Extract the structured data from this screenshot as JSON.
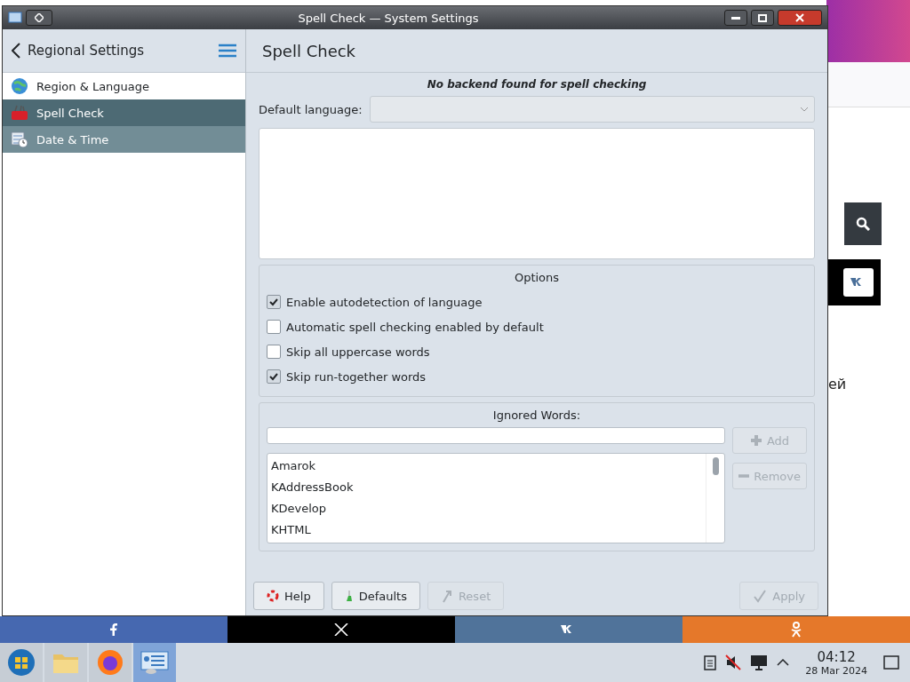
{
  "background_browser": {
    "fragment_text": "ей",
    "share_bar": [
      {
        "kind": "facebook",
        "color": "#4668b0"
      },
      {
        "kind": "x",
        "color": "#000000"
      },
      {
        "kind": "vk",
        "color": "#50739a"
      },
      {
        "kind": "ok",
        "color": "#e5782a"
      }
    ]
  },
  "window": {
    "title": "Spell Check — System Settings"
  },
  "sidebar": {
    "title": "Regional Settings",
    "items": [
      {
        "label": "Region & Language",
        "kind": "globe",
        "selected": false,
        "hovered": false
      },
      {
        "label": "Spell Check",
        "kind": "spell",
        "selected": true,
        "hovered": false
      },
      {
        "label": "Date & Time",
        "kind": "calendar",
        "selected": false,
        "hovered": true
      }
    ]
  },
  "page": {
    "title": "Spell Check",
    "notice": "No backend found for spell checking",
    "default_language": {
      "label": "Default language:",
      "disabled": true
    },
    "options": {
      "title": "Options",
      "items": [
        {
          "label": "Enable autodetection of language",
          "checked": true
        },
        {
          "label": "Automatic spell checking enabled by default",
          "checked": false
        },
        {
          "label": "Skip all uppercase words",
          "checked": false
        },
        {
          "label": "Skip run-together words",
          "checked": true
        }
      ]
    },
    "ignored_words": {
      "title": "Ignored Words:",
      "buttons": [
        {
          "label": "Add",
          "kind": "add",
          "disabled": true
        },
        {
          "label": "Remove",
          "kind": "remove",
          "disabled": true
        }
      ],
      "words": [
        "Amarok",
        "KAddressBook",
        "KDevelop",
        "KHTML"
      ]
    }
  },
  "footer_buttons": [
    {
      "label": "Help",
      "kind": "help",
      "disabled": false
    },
    {
      "label": "Defaults",
      "kind": "defaults",
      "disabled": false
    },
    {
      "label": "Reset",
      "kind": "reset",
      "disabled": true
    },
    {
      "label": "Apply",
      "kind": "apply",
      "disabled": true
    }
  ],
  "taskbar": {
    "apps": [
      {
        "kind": "start",
        "active": false
      },
      {
        "kind": "folder",
        "active": false
      },
      {
        "kind": "firefox",
        "active": false
      },
      {
        "kind": "settings",
        "active": true
      }
    ],
    "time": "04:12",
    "date": "28 Mar 2024"
  }
}
